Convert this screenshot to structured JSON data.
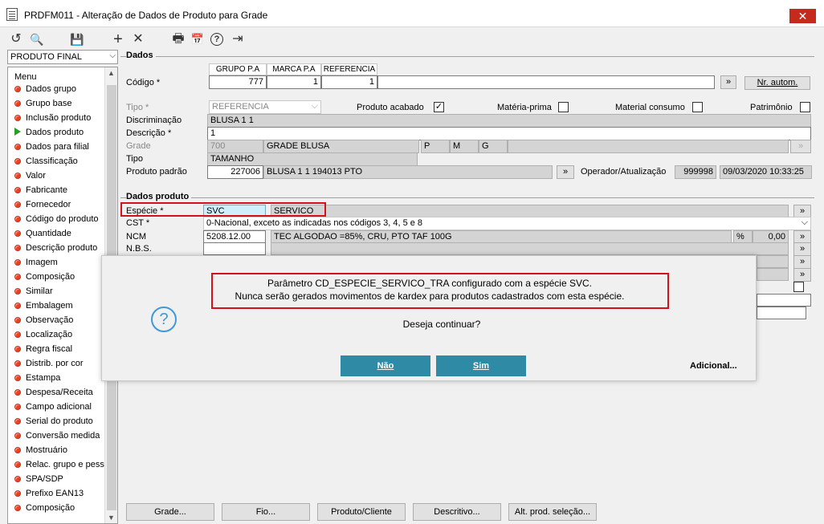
{
  "window": {
    "title": "PRDFM011 - Alteração de Dados de Produto para Grade",
    "close": "✕"
  },
  "toolbar": {
    "undo": "↺",
    "search": "🔍",
    "save": "💾",
    "add": "+",
    "delete": "✕",
    "print": "🖶",
    "calendar": "📅",
    "help": "?",
    "exit": "⇥"
  },
  "left": {
    "combo_value": "PRODUTO FINAL",
    "menu_title": "Menu",
    "items": [
      "Dados grupo",
      "Grupo base",
      "Inclusão produto",
      "Dados produto",
      "Dados para filial",
      "Classificação",
      "Valor",
      "Fabricante",
      "Fornecedor",
      "Código do produto",
      "Quantidade",
      "Descrição produto",
      "Imagem",
      "Composição",
      "Similar",
      "Embalagem",
      "Observação",
      "Localização",
      "Regra fiscal",
      "Distrib. por cor",
      "Estampa",
      "Despesa/Receita",
      "Campo adicional",
      "Serial do produto",
      "Conversão medida",
      "Mostruário",
      "Relac. grupo e pess",
      "SPA/SDP",
      "Prefixo EAN13",
      "Composição"
    ]
  },
  "dados": {
    "title": "Dados",
    "codigo_label": "Código *",
    "col_headers": [
      "GRUPO P.A",
      "MARCA P.A",
      "REFERENCIA"
    ],
    "col_values": [
      "777",
      "1",
      "1"
    ],
    "arrow_btn": "»",
    "nr_autom": "Nr. autom.",
    "tipo_label": "Tipo *",
    "tipo_value": "REFERENCIA",
    "produto_acabado": "Produto acabado",
    "materia_prima": "Matéria-prima",
    "material_consumo": "Material consumo",
    "patrimonio": "Patrimônio",
    "discriminacao_label": "Discriminação",
    "discriminacao_value": "BLUSA 1 1",
    "descricao_label": "Descrição *",
    "descricao_value": "1",
    "grade_label": "Grade",
    "grade_code": "700",
    "grade_name": "GRADE BLUSA",
    "grade_sizes": [
      "P",
      "M",
      "G"
    ],
    "tipo2_label": "Tipo",
    "tipo2_value": "TAMANHO",
    "produto_padrao_label": "Produto padrão",
    "produto_padrao_code": "227006",
    "produto_padrao_desc": "BLUSA 1 1 194013 PTO",
    "operador_label": "Operador/Atualização",
    "operador_value": "999998",
    "data_value": "09/03/2020 10:33:25"
  },
  "dados_produto": {
    "title": "Dados produto",
    "especie_label": "Espécie *",
    "especie_code": "SVC",
    "especie_desc": "SERVICO",
    "cst_label": "CST *",
    "cst_value": "0-Nacional, exceto as indicadas nos códigos 3, 4, 5 e 8",
    "ncm_label": "NCM",
    "ncm_code": "5208.12.00",
    "ncm_desc": "TEC ALGODAO  =85%, CRU, PTO TAF 100G",
    "ncm_pct": "%",
    "ncm_value": "0,00",
    "nbs_label": "N.B.S."
  },
  "dialog": {
    "line1": "Parâmetro CD_ESPECIE_SERVICO_TRA configurado com a espécie SVC.",
    "line2": "Nunca serão gerados movimentos de kardex para produtos cadastrados com esta espécie.",
    "question": "Deseja continuar?",
    "nao": "Não",
    "sim": "Sim",
    "adicional": "Adicional..."
  },
  "bottom_buttons": [
    "Grade...",
    "Fio...",
    "Produto/Cliente",
    "Descritivo...",
    "Alt. prod. seleção..."
  ]
}
